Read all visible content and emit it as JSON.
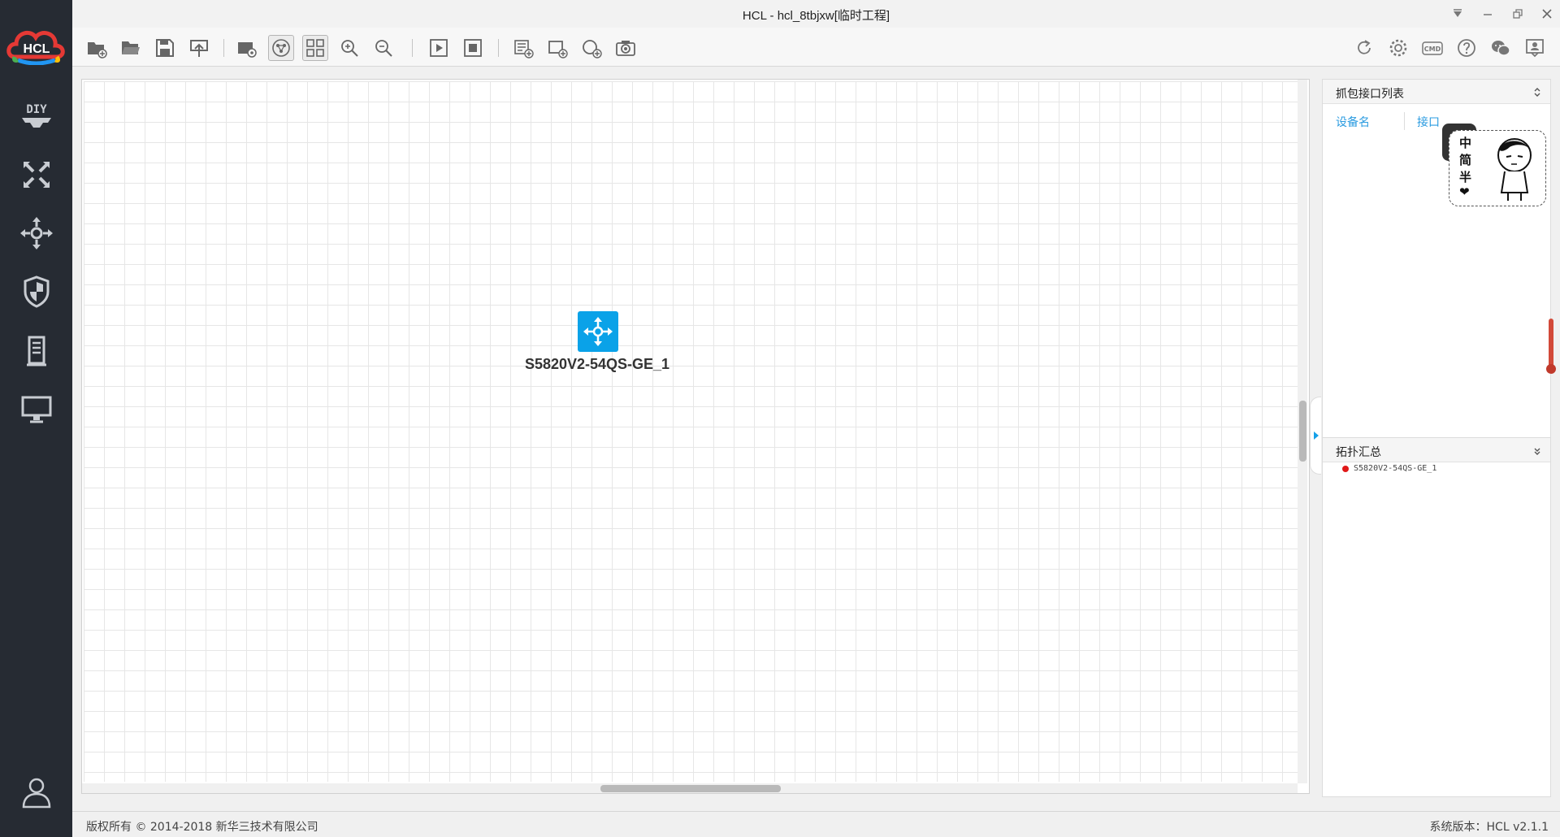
{
  "window": {
    "title": "HCL - hcl_8tbjxw[临时工程]"
  },
  "logo": {
    "text": "HCL"
  },
  "canvas": {
    "devices": [
      {
        "name": "S5820V2-54QS-GE_1",
        "icon": "switch-icon",
        "color": "#0aa2e8"
      }
    ]
  },
  "right_panel": {
    "capture_section": {
      "title": "抓包接口列表",
      "columns": [
        "设备名",
        "接口"
      ]
    },
    "topology_section": {
      "title": "拓扑汇总",
      "items": [
        {
          "label": "S5820V2-54QS-GE_1",
          "status_color": "#e01818"
        }
      ]
    }
  },
  "sticker": {
    "chars": [
      "中",
      "简",
      "半",
      "❤"
    ]
  },
  "statusbar": {
    "copyright": "版权所有 © 2014-2018 新华三技术有限公司",
    "version": "系统版本：HCL v2.1.1"
  },
  "colors": {
    "sidebar_bg": "#262b33",
    "accent": "#0aa2e8",
    "link": "#2a9be0"
  }
}
